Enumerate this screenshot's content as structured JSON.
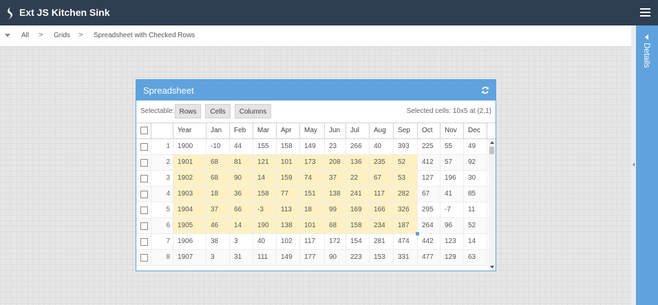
{
  "app": {
    "title": "Ext JS Kitchen Sink",
    "logo_icon": "sencha-logo-icon",
    "menu_icon": "hamburger-menu-icon"
  },
  "breadcrumb": {
    "items": [
      "All",
      "Grids",
      "Spreadsheet with Checked Rows"
    ],
    "separator": ">"
  },
  "details_panel": {
    "label": "Details"
  },
  "panel": {
    "title": "Spreadsheet",
    "refresh_icon": "refresh-icon",
    "toolbar": {
      "label": "Selectable:",
      "buttons": [
        "Rows",
        "Cells",
        "Columns"
      ],
      "status": "Selected cells: 10x5 at (2,1)"
    }
  },
  "grid": {
    "columns": [
      "",
      "",
      "Year",
      "Jan",
      "Feb",
      "Mar",
      "Apr",
      "May",
      "Jun",
      "Jul",
      "Aug",
      "Sep",
      "Oct",
      "Nov",
      "Dec"
    ],
    "rows": [
      {
        "num": "1",
        "year": "1900",
        "values": [
          "-10",
          "44",
          "155",
          "158",
          "149",
          "23",
          "266",
          "40",
          "393",
          "225",
          "55",
          "49"
        ]
      },
      {
        "num": "2",
        "year": "1901",
        "values": [
          "68",
          "81",
          "121",
          "101",
          "173",
          "208",
          "136",
          "235",
          "52",
          "412",
          "57",
          "92"
        ]
      },
      {
        "num": "3",
        "year": "1902",
        "values": [
          "68",
          "90",
          "14",
          "159",
          "74",
          "37",
          "22",
          "67",
          "53",
          "127",
          "196",
          "30"
        ]
      },
      {
        "num": "4",
        "year": "1903",
        "values": [
          "18",
          "36",
          "158",
          "77",
          "151",
          "138",
          "241",
          "117",
          "282",
          "67",
          "41",
          "85"
        ]
      },
      {
        "num": "5",
        "year": "1904",
        "values": [
          "37",
          "66",
          "-3",
          "113",
          "18",
          "99",
          "169",
          "166",
          "326",
          "295",
          "-7",
          "11"
        ]
      },
      {
        "num": "6",
        "year": "1905",
        "values": [
          "46",
          "14",
          "190",
          "138",
          "101",
          "68",
          "158",
          "234",
          "187",
          "264",
          "96",
          "52"
        ]
      },
      {
        "num": "7",
        "year": "1906",
        "values": [
          "38",
          "3",
          "40",
          "102",
          "117",
          "172",
          "154",
          "281",
          "474",
          "442",
          "123",
          "14"
        ]
      },
      {
        "num": "8",
        "year": "1907",
        "values": [
          "3",
          "31",
          "111",
          "149",
          "177",
          "90",
          "223",
          "153",
          "331",
          "477",
          "129",
          "63"
        ]
      }
    ],
    "selection": {
      "first_row": 2,
      "last_row": 6,
      "first_col": "Year",
      "last_col": "Sep",
      "color": "#fdf1c4"
    }
  },
  "colors": {
    "topbar": "#2f3e50",
    "accent": "#5fa2dd",
    "selection": "#fdf1c4"
  }
}
